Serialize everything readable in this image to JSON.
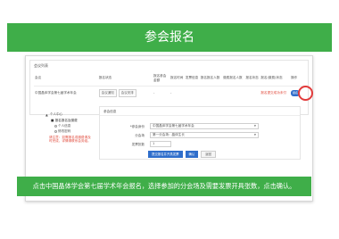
{
  "banner": {
    "title": "参会报名"
  },
  "list": {
    "section_title": "会议列表",
    "columns": [
      "会议",
      "报名状态",
      "报名参会金额",
      "报名时间",
      "发票信息",
      "报名报名人数",
      "缴费报名人数",
      "报名状态",
      "报名(缴费)状态",
      "操作"
    ],
    "row": {
      "meeting": "中国晶体学会第七届学术年会",
      "status_buttons": [
        "会议通知",
        "会议安排"
      ],
      "fee": "-",
      "time": "-",
      "invoice": "",
      "count1": "",
      "count2": "",
      "state": "",
      "pay_state": "报名提交成功未付",
      "op": "报名"
    }
  },
  "sidebar": {
    "user": "个人中心",
    "items": [
      {
        "label": "报名报名及缴费"
      },
      {
        "label": "个人信息"
      },
      {
        "label": "修改密码"
      }
    ],
    "note": "请注意：如需报名或缴费请及时完成，详情请联系会务组。"
  },
  "form": {
    "title": "参会信息",
    "fields": [
      {
        "label": "*参会身份",
        "value": "中国晶体学会第七届学术年会"
      },
      {
        "label": "分会场",
        "value": "第一分会场：晶体生长"
      },
      {
        "label": "发票张数",
        "value": "1"
      }
    ],
    "buttons": [
      "提交报名并开具发票",
      "确认",
      "返回"
    ]
  },
  "caption": {
    "text": "点击中国晶体学会第七届学术年会报名，选择参加的分会场及需要发票开具张数，点击确认。"
  },
  "colors": {
    "accent": "#3fae49",
    "primary": "#2f6ecb",
    "alert": "#e23b3b"
  }
}
